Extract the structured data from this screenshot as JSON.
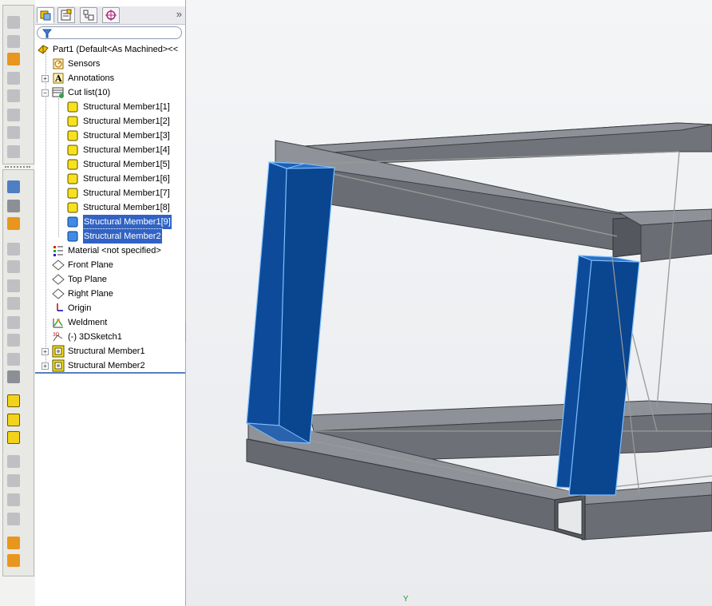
{
  "feature_manager": {
    "filter_placeholder": "",
    "root": "Part1  (Default<As Machined><<",
    "items": {
      "sensors": "Sensors",
      "annotations": "Annotations",
      "cut_list": "Cut list(10)",
      "material": "Material <not specified>",
      "front_plane": "Front Plane",
      "top_plane": "Top Plane",
      "right_plane": "Right Plane",
      "origin": "Origin",
      "weldment": "Weldment",
      "sketch": "(-) 3DSketch1",
      "sm1": "Structural Member1",
      "sm2": "Structural Member2"
    },
    "cut_list_items": [
      "Structural Member1[1]",
      "Structural Member1[2]",
      "Structural Member1[3]",
      "Structural Member1[4]",
      "Structural Member1[5]",
      "Structural Member1[6]",
      "Structural Member1[7]",
      "Structural Member1[8]",
      "Structural Member1[9]",
      "Structural Member2"
    ],
    "expand_glyph": "»",
    "tree_collapse": "−",
    "tree_expand": "+"
  },
  "viewport": {
    "axis_label": "Y"
  },
  "colors": {
    "selection": "#3163c5",
    "frame_steel": "#6a6d74",
    "selected_member": "#0d4b9a",
    "highlight_edge": "#7fc0ff"
  }
}
